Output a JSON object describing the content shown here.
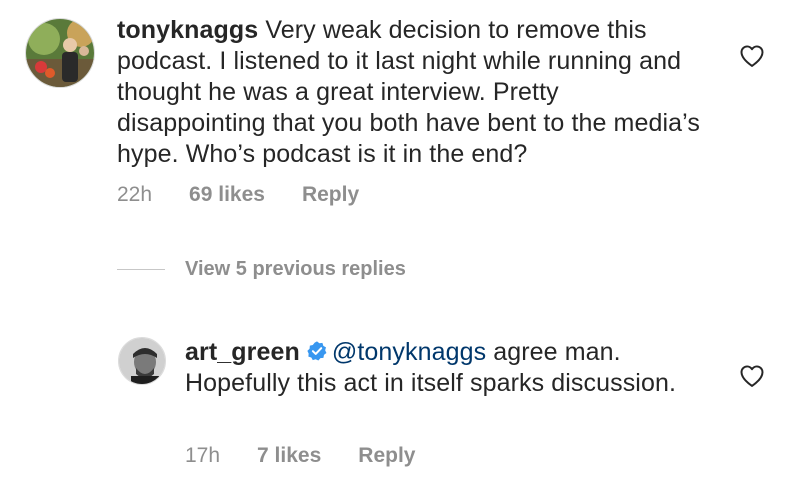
{
  "comment": {
    "username": "tonyknaggs",
    "text": " Very weak decision to remove this podcast. I listened to it last night while running and thought he was a great interview. Pretty disappointing that you both have bent to the media’s hype. Who’s podcast is it in the end?",
    "time": "22h",
    "likes": "69 likes",
    "reply_label": "Reply",
    "avatar_icon": "avatar-photo"
  },
  "view_replies": {
    "label": "View 5 previous replies"
  },
  "reply": {
    "username": "art_green",
    "verified_icon": "verified-badge-icon",
    "mention": "@tonyknaggs",
    "text": " agree man. Hopefully this act in itself sparks discussion.",
    "time": "17h",
    "likes": "7 likes",
    "reply_label": "Reply",
    "avatar_icon": "avatar-photo"
  },
  "icons": {
    "like": "heart-outline-icon"
  },
  "colors": {
    "text": "#262626",
    "meta": "#8e8e8e",
    "mention": "#00376b",
    "verified": "#3897f0"
  }
}
